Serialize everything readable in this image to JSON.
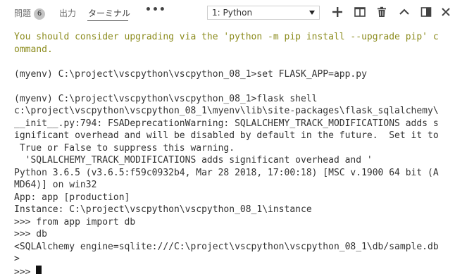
{
  "tabs": {
    "problems_label": "問題",
    "problems_count": "6",
    "output_label": "出力",
    "terminal_label": "ターミナル",
    "more_label": "•••"
  },
  "terminal_select": {
    "value": "1: Python"
  },
  "toolbar": {
    "icons": [
      "plus-icon",
      "split-icon",
      "trash-icon",
      "chevron-up-icon",
      "maximize-panel-icon",
      "close-icon"
    ]
  },
  "terminal": {
    "lines": [
      {
        "text": "You should consider upgrading via the 'python -m pip install --upgrade pip' c",
        "style": "warn"
      },
      {
        "text": "ommand.",
        "style": "warn"
      },
      {
        "text": "",
        "style": "normal"
      },
      {
        "text": "(myenv) C:\\project\\vscpython\\vscpython_08_1>set FLASK_APP=app.py",
        "style": "normal"
      },
      {
        "text": "",
        "style": "normal"
      },
      {
        "text": "(myenv) C:\\project\\vscpython\\vscpython_08_1>flask shell",
        "style": "normal"
      },
      {
        "text": "c:\\project\\vscpython\\vscpython_08_1\\myenv\\lib\\site-packages\\flask_sqlalchemy\\",
        "style": "normal"
      },
      {
        "text": "__init__.py:794: FSADeprecationWarning: SQLALCHEMY_TRACK_MODIFICATIONS adds s",
        "style": "normal"
      },
      {
        "text": "ignificant overhead and will be disabled by default in the future.  Set it to",
        "style": "normal"
      },
      {
        "text": " True or False to suppress this warning.",
        "style": "normal"
      },
      {
        "text": "  'SQLALCHEMY_TRACK_MODIFICATIONS adds significant overhead and '",
        "style": "normal"
      },
      {
        "text": "Python 3.6.5 (v3.6.5:f59c0932b4, Mar 28 2018, 17:00:18) [MSC v.1900 64 bit (A",
        "style": "normal"
      },
      {
        "text": "MD64)] on win32",
        "style": "normal"
      },
      {
        "text": "App: app [production]",
        "style": "normal"
      },
      {
        "text": "Instance: C:\\project\\vscpython\\vscpython_08_1\\instance",
        "style": "normal"
      },
      {
        "text": ">>> from app import db",
        "style": "normal"
      },
      {
        "text": ">>> db",
        "style": "normal"
      },
      {
        "text": "<SQLAlchemy engine=sqlite:///C:\\project\\vscpython\\vscpython_08_1\\db/sample.db",
        "style": "normal"
      },
      {
        "text": ">",
        "style": "normal"
      }
    ],
    "prompt": ">>> "
  }
}
